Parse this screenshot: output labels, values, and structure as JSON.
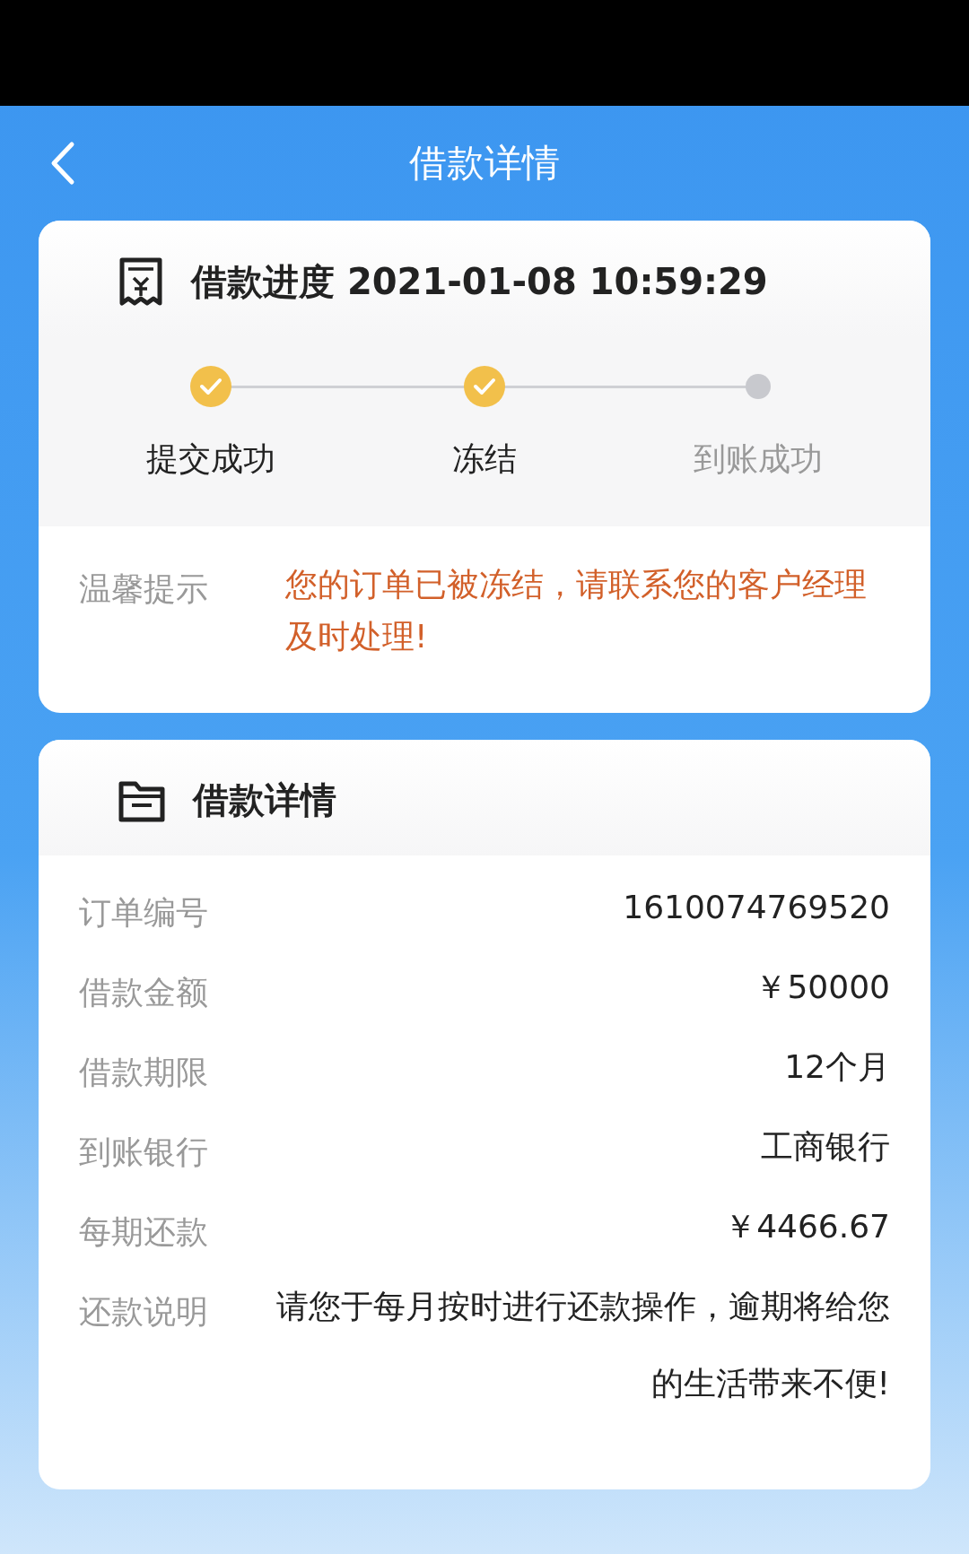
{
  "nav": {
    "title": "借款详情"
  },
  "progress": {
    "title": "借款进度 2021-01-08 10:59:29",
    "steps": [
      {
        "label": "提交成功",
        "done": true
      },
      {
        "label": "冻结",
        "done": true
      },
      {
        "label": "到账成功",
        "done": false
      }
    ],
    "tip_label": "温馨提示",
    "tip_text": "您的订单已被冻结，请联系您的客户经理及时处理!"
  },
  "details": {
    "title": "借款详情",
    "rows": [
      {
        "label": "订单编号",
        "value": "1610074769520"
      },
      {
        "label": "借款金额",
        "value": "￥50000"
      },
      {
        "label": "借款期限",
        "value": "12个月"
      },
      {
        "label": "到账银行",
        "value": "工商银行"
      },
      {
        "label": "每期还款",
        "value": "￥4466.67"
      },
      {
        "label": "还款说明",
        "value": "请您于每月按时进行还款操作，逾期将给您的生活带来不便!"
      }
    ]
  }
}
